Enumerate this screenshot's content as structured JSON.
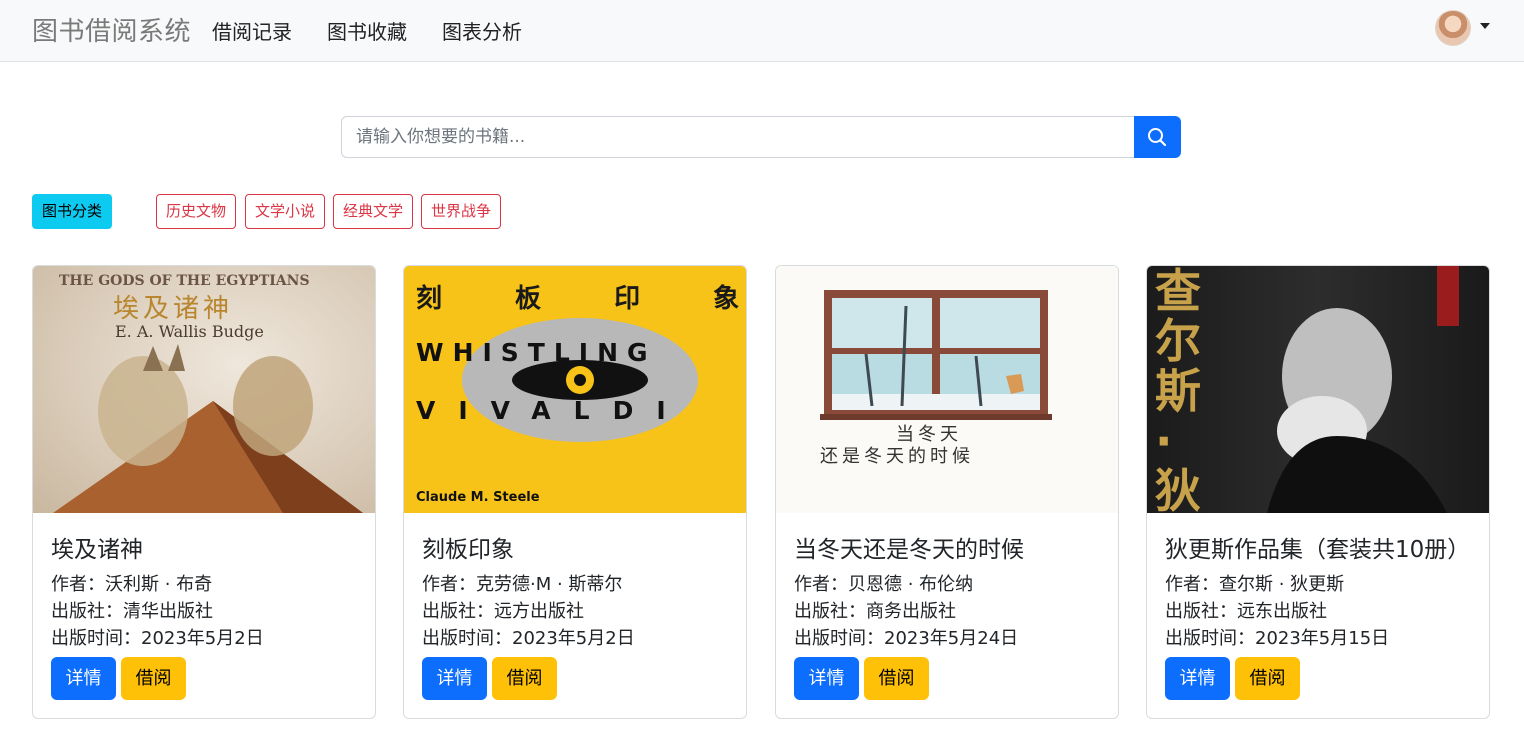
{
  "nav": {
    "brand": "图书借阅系统",
    "links": [
      "借阅记录",
      "图书收藏",
      "图表分析"
    ]
  },
  "search": {
    "placeholder": "请输入你想要的书籍...",
    "button_icon": "search-icon"
  },
  "categories": {
    "title": "图书分类",
    "tags": [
      "历史文物",
      "文学小说",
      "经典文学",
      "世界战争"
    ]
  },
  "books": [
    {
      "title": "埃及诸神",
      "author": "作者：沃利斯 · 布奇",
      "publisher": "出版社：清华出版社",
      "date": "出版时间：2023年5月2日",
      "detail_label": "详情",
      "borrow_label": "借阅",
      "cover": {
        "line1": "THE GODS OF THE EGYPTIANS",
        "line2": "埃及诸神",
        "line3": "E. A. Wallis Budge"
      }
    },
    {
      "title": "刻板印象",
      "author": "作者：克劳德·M · 斯蒂尔",
      "publisher": "出版社：远方出版社",
      "date": "出版时间：2023年5月2日",
      "detail_label": "详情",
      "borrow_label": "借阅",
      "cover": {
        "line1": "刻 板 印 象",
        "line2": "WHISTLING",
        "line3": "VIVALDI",
        "line4": "Claude M. Steele"
      }
    },
    {
      "title": "当冬天还是冬天的时候",
      "author": "作者：贝恩德 · 布伦纳",
      "publisher": "出版社：商务出版社",
      "date": "出版时间：2023年5月24日",
      "detail_label": "详情",
      "borrow_label": "借阅",
      "cover": {
        "line1": "当冬天",
        "line2": "还是冬天的时候"
      }
    },
    {
      "title": "狄更斯作品集（套装共10册）",
      "author": "作者：查尔斯 · 狄更斯",
      "publisher": "出版社：远东出版社",
      "date": "出版时间：2023年5月15日",
      "detail_label": "详情",
      "borrow_label": "借阅",
      "cover": {
        "line1": "查尔斯·狄更斯"
      }
    }
  ],
  "colors": {
    "primary": "#0d6efd",
    "info": "#0dcaf0",
    "warning": "#ffc107",
    "danger": "#dc3545"
  }
}
